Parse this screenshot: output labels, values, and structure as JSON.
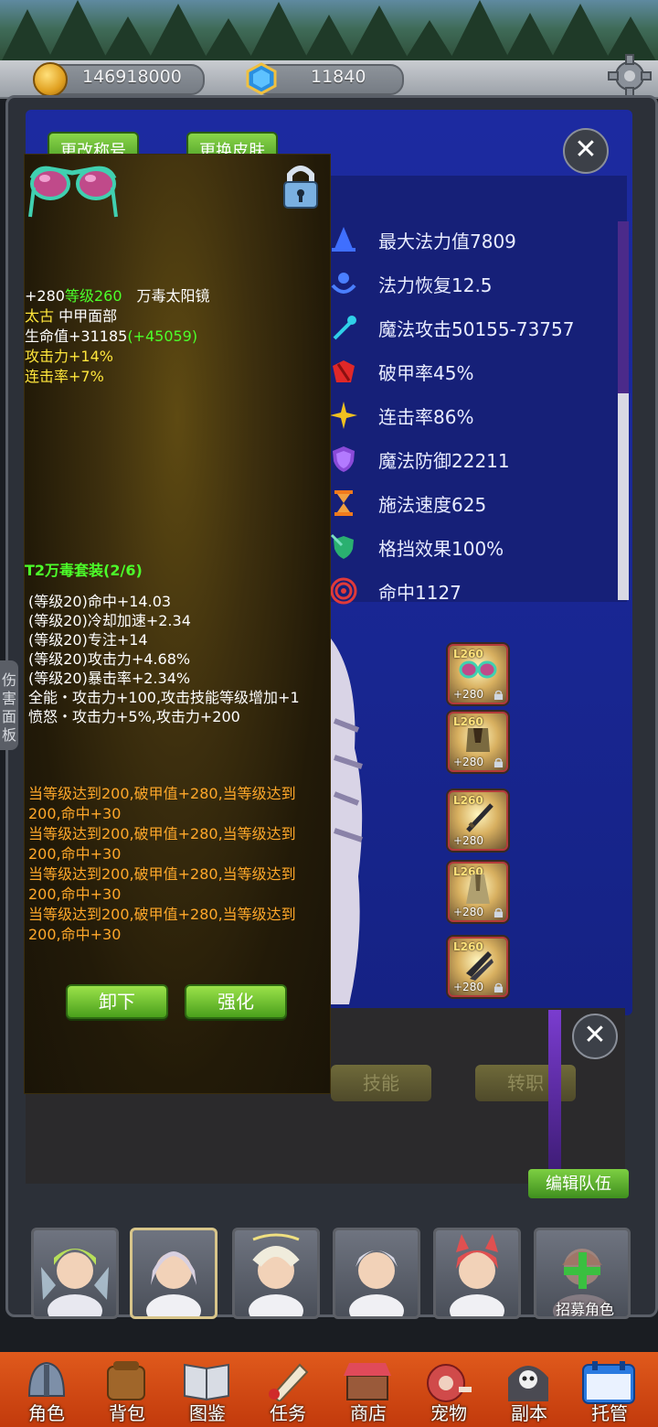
{
  "currency": {
    "gold": "146918000",
    "gems": "11840"
  },
  "tabs": {
    "change_title": "更改称号",
    "change_skin": "更换皮肤"
  },
  "stats": [
    {
      "icon": "wizard-hat-icon",
      "label": "最大法力值7809",
      "color": "#3f6fff"
    },
    {
      "icon": "mana-regen-icon",
      "label": "法力恢复12.5",
      "color": "#4a7fff"
    },
    {
      "icon": "magic-wand-icon",
      "label": "魔法攻击50155-73757",
      "color": "#2fd0e8"
    },
    {
      "icon": "armor-break-icon",
      "label": "破甲率45%",
      "color": "#e02828"
    },
    {
      "icon": "combo-star-icon",
      "label": "连击率86%",
      "color": "#f0c020"
    },
    {
      "icon": "magic-shield-icon",
      "label": "魔法防御22211",
      "color": "#8a4ad8"
    },
    {
      "icon": "hourglass-icon",
      "label": "施法速度625",
      "color": "#f07a1c"
    },
    {
      "icon": "block-shield-icon",
      "label": "格挡效果100%",
      "color": "#2ab070"
    },
    {
      "icon": "target-icon",
      "label": "命中1127",
      "color": "#e03a3a"
    }
  ],
  "damage_panel": {
    "label": "伤害面板"
  },
  "equipment_slots": [
    {
      "level": "L260",
      "plus": "+280",
      "icon": "sunglasses-icon"
    },
    {
      "level": "L260",
      "plus": "+280",
      "icon": "armor-icon"
    },
    {
      "level": "L260",
      "plus": "+280",
      "icon": "weapon-icon"
    },
    {
      "level": "L260",
      "plus": "+280",
      "icon": "robe-icon"
    },
    {
      "level": "L260",
      "plus": "+280",
      "icon": "boots-icon"
    }
  ],
  "lower_buttons": {
    "skill": "技能",
    "class_change": "转职",
    "edit_team": "编辑队伍"
  },
  "roster": {
    "recruit": "招募角色"
  },
  "nav": [
    {
      "label": "角色",
      "icon": "helmet-icon"
    },
    {
      "label": "背包",
      "icon": "backpack-icon"
    },
    {
      "label": "图鉴",
      "icon": "book-icon"
    },
    {
      "label": "任务",
      "icon": "quest-scroll-icon"
    },
    {
      "label": "商店",
      "icon": "shop-icon"
    },
    {
      "label": "宠物",
      "icon": "pet-icon"
    },
    {
      "label": "副本",
      "icon": "dungeon-skull-icon"
    },
    {
      "label": "托管",
      "icon": "calendar-icon"
    }
  ],
  "tooltip": {
    "enhance": "+280",
    "level_label": "等级260",
    "item_name": "万毒太阳镜",
    "quality": "太古",
    "slot_type": "中甲面部",
    "hp_base": "生命值+31185",
    "hp_bonus": "(+45059)",
    "attr1": "攻击力+14%",
    "attr2": "连击率+7%",
    "set_title": "T2万毒套装(2/6)",
    "set_bonuses": [
      "(等级20)命中+14.03",
      "(等级20)冷却加速+2.34",
      "(等级20)专注+14",
      "(等级20)攻击力+4.68%",
      "(等级20)暴击率+2.34%",
      "全能・攻击力+100,攻击技能等级增加+1",
      "愤怒・攻击力+5%,攻击力+200"
    ],
    "level_bonuses": [
      "当等级达到200,破甲值+280,当等级达到",
      "200,命中+30",
      "当等级达到200,破甲值+280,当等级达到",
      "200,命中+30",
      "当等级达到200,破甲值+280,当等级达到",
      "200,命中+30",
      "当等级达到200,破甲值+280,当等级达到",
      "200,命中+30"
    ],
    "unequip": "卸下",
    "enhance_button": "强化"
  }
}
